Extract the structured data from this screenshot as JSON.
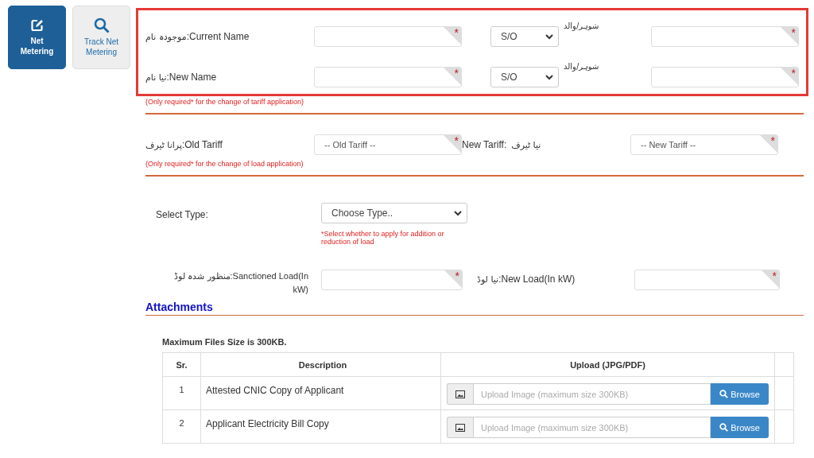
{
  "nav": [
    {
      "label": "Net Metering",
      "kind": "edit",
      "selected": true
    },
    {
      "label": "Track Net Metering",
      "kind": "search",
      "selected": false
    }
  ],
  "required_mark": "*",
  "name_section": {
    "highlighted": true,
    "rows": [
      {
        "label_ur": "موجودہ نام",
        "label_en": ":Current Name",
        "required": true,
        "relation": "S/O",
        "relation_label": "شوہر/والد",
        "relation_required": true
      },
      {
        "label_ur": "نیا نام",
        "label_en": ":New Name",
        "required": true,
        "relation": "S/O",
        "relation_label": "شوہر/والد",
        "relation_required": true
      }
    ],
    "note": "(Only required* for the change of tariff application)"
  },
  "tariff": {
    "old_label_ur": "پرانا ٹیرف",
    "old_label_en": ":Old Tariff",
    "old_placeholder": "-- Old Tariff --",
    "old_required": true,
    "new_label_en": "New Tariff:",
    "new_label_ur": "نیا ٹیرف",
    "new_placeholder": "-- New Tariff --",
    "new_required": true,
    "note": "(Only required* for the change of load application)"
  },
  "select_type": {
    "label": "Select Type:",
    "placeholder": "Choose Type..",
    "note": "*Select whether to apply for addition or reduction of load"
  },
  "load": {
    "sanctioned_label_ur": "منظور شدہ لوڈ",
    "sanctioned_label_en": ":Sanctioned Load(In kW)",
    "sanctioned_required": true,
    "new_label_ur": "نیا لوڈ",
    "new_label_en": ":New Load(In kW)",
    "new_required": true
  },
  "attachments": {
    "title": "Attachments",
    "max_size": "Maximum Files Size is 300KB.",
    "columns": [
      "Sr.",
      "Description",
      "Upload (JPG/PDF)"
    ],
    "rows": [
      {
        "sr": "1",
        "description": "Attested CNIC Copy of Applicant",
        "placeholder": "Upload Image (maximum size 300KB)",
        "button": "Browse"
      },
      {
        "sr": "2",
        "description": "Applicant Electricity Bill Copy",
        "placeholder": "Upload Image (maximum size 300KB)",
        "button": "Browse"
      }
    ]
  }
}
